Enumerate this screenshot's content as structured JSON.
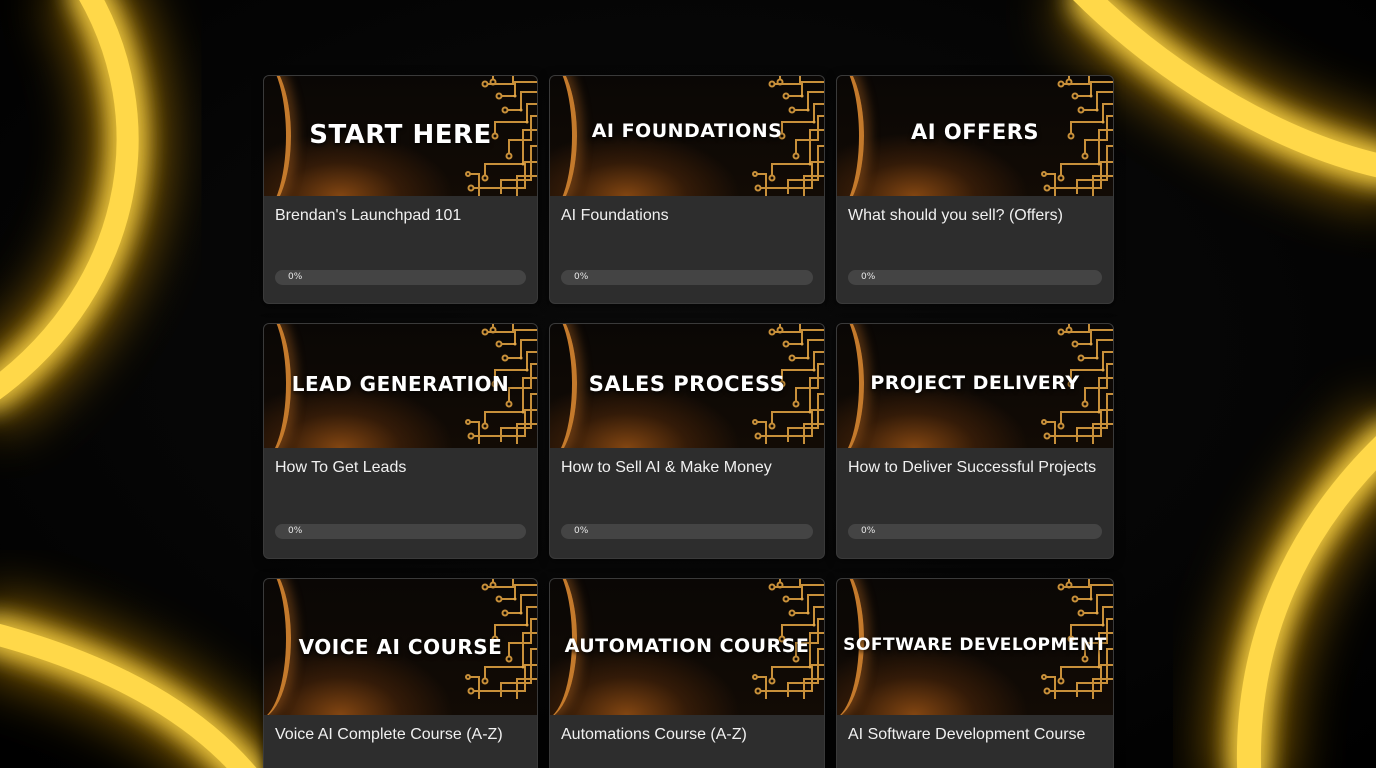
{
  "theme": {
    "glow_color": "#ffd84a",
    "card_bg": "#2d2d2d",
    "accent": "#c47a2c"
  },
  "courses": [
    {
      "banner": "START HERE",
      "name": "Brendan's Launchpad 101",
      "progress": "0%"
    },
    {
      "banner": "AI FOUNDATIONS",
      "name": "AI Foundations",
      "progress": "0%"
    },
    {
      "banner": "AI OFFERS",
      "name": "What should you sell? (Offers)",
      "progress": "0%"
    },
    {
      "banner": "LEAD GENERATION",
      "name": "How To Get Leads",
      "progress": "0%"
    },
    {
      "banner": "SALES PROCESS",
      "name": "How to Sell AI & Make Money",
      "progress": "0%"
    },
    {
      "banner": "PROJECT DELIVERY",
      "name": "How to Deliver Successful Projects",
      "progress": "0%"
    },
    {
      "banner": "VOICE AI COURSE",
      "name": "Voice AI Complete Course (A-Z)"
    },
    {
      "banner": "AUTOMATION COURSE",
      "name": "Automations Course (A-Z)"
    },
    {
      "banner": "SOFTWARE DEVELOPMENT",
      "name": "AI Software Development Course"
    }
  ]
}
